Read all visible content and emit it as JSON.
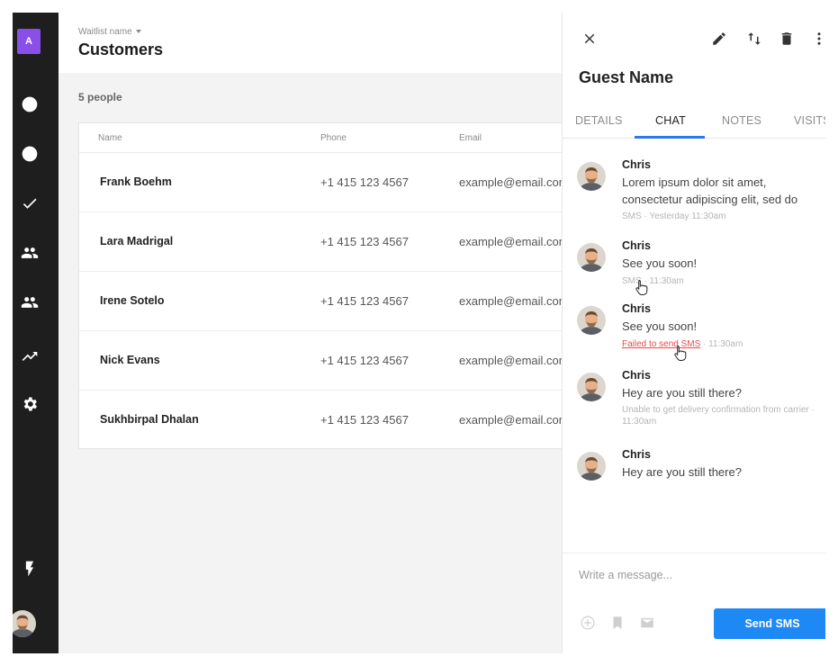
{
  "sidebar": {
    "org_initial": "A",
    "icons": [
      "clock-icon",
      "history-icon",
      "check-icon",
      "people-icon",
      "group-icon",
      "trending-icon",
      "gear-icon"
    ],
    "bolt_icon": "bolt-icon"
  },
  "header": {
    "waitlist_label": "Waitlist name",
    "title": "Customers"
  },
  "count_label": "5 people",
  "table": {
    "columns": [
      "Name",
      "Phone",
      "Email"
    ],
    "rows": [
      {
        "name": "Frank Boehm",
        "phone": "+1 415 123 4567",
        "email": "example@email.com"
      },
      {
        "name": "Lara Madrigal",
        "phone": "+1 415 123 4567",
        "email": "example@email.com"
      },
      {
        "name": "Irene Sotelo",
        "phone": "+1 415 123 4567",
        "email": "example@email.com"
      },
      {
        "name": "Nick Evans",
        "phone": "+1 415 123 4567",
        "email": "example@email.com"
      },
      {
        "name": "Sukhbirpal Dhalan",
        "phone": "+1 415 123 4567",
        "email": "example@email.com"
      }
    ]
  },
  "panel": {
    "guest_name": "Guest Name",
    "tabs": [
      "DETAILS",
      "CHAT",
      "NOTES",
      "VISITS"
    ],
    "active_tab": "CHAT",
    "messages": [
      {
        "author": "Chris",
        "text": "Lorem ipsum dolor sit amet, consectetur adipiscing elit, sed do",
        "meta": "SMS · Yesterday 11:30am"
      },
      {
        "author": "Chris",
        "text": "See you soon!",
        "meta": "SMS · 11:30am"
      },
      {
        "author": "Chris",
        "text": "See you soon!",
        "meta_fail": "Failed to send SMS",
        "meta": " · 11:30am"
      },
      {
        "author": "Chris",
        "text": "Hey are you still there?",
        "meta": "Unable to get delivery confirmation from carrier · 11:30am"
      },
      {
        "author": "Chris",
        "text": "Hey are you still there?",
        "meta": ""
      }
    ],
    "compose_placeholder": "Write a message...",
    "send_label": "Send SMS"
  },
  "colors": {
    "sidebar_bg": "#1e1e1e",
    "org_badge": "#8a4fe8",
    "accent": "#1e88f5",
    "error": "#e84a4a"
  }
}
